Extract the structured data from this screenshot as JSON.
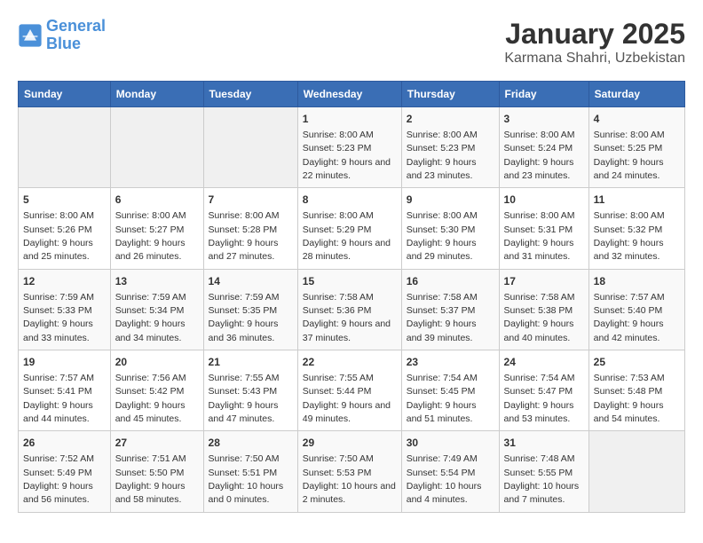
{
  "header": {
    "logo_line1": "General",
    "logo_line2": "Blue",
    "title": "January 2025",
    "subtitle": "Karmana Shahri, Uzbekistan"
  },
  "columns": [
    "Sunday",
    "Monday",
    "Tuesday",
    "Wednesday",
    "Thursday",
    "Friday",
    "Saturday"
  ],
  "weeks": [
    [
      {
        "day": "",
        "sunrise": "",
        "sunset": "",
        "daylight": "",
        "empty": true
      },
      {
        "day": "",
        "sunrise": "",
        "sunset": "",
        "daylight": "",
        "empty": true
      },
      {
        "day": "",
        "sunrise": "",
        "sunset": "",
        "daylight": "",
        "empty": true
      },
      {
        "day": "1",
        "sunrise": "Sunrise: 8:00 AM",
        "sunset": "Sunset: 5:23 PM",
        "daylight": "Daylight: 9 hours and 22 minutes."
      },
      {
        "day": "2",
        "sunrise": "Sunrise: 8:00 AM",
        "sunset": "Sunset: 5:23 PM",
        "daylight": "Daylight: 9 hours and 23 minutes."
      },
      {
        "day": "3",
        "sunrise": "Sunrise: 8:00 AM",
        "sunset": "Sunset: 5:24 PM",
        "daylight": "Daylight: 9 hours and 23 minutes."
      },
      {
        "day": "4",
        "sunrise": "Sunrise: 8:00 AM",
        "sunset": "Sunset: 5:25 PM",
        "daylight": "Daylight: 9 hours and 24 minutes."
      }
    ],
    [
      {
        "day": "5",
        "sunrise": "Sunrise: 8:00 AM",
        "sunset": "Sunset: 5:26 PM",
        "daylight": "Daylight: 9 hours and 25 minutes."
      },
      {
        "day": "6",
        "sunrise": "Sunrise: 8:00 AM",
        "sunset": "Sunset: 5:27 PM",
        "daylight": "Daylight: 9 hours and 26 minutes."
      },
      {
        "day": "7",
        "sunrise": "Sunrise: 8:00 AM",
        "sunset": "Sunset: 5:28 PM",
        "daylight": "Daylight: 9 hours and 27 minutes."
      },
      {
        "day": "8",
        "sunrise": "Sunrise: 8:00 AM",
        "sunset": "Sunset: 5:29 PM",
        "daylight": "Daylight: 9 hours and 28 minutes."
      },
      {
        "day": "9",
        "sunrise": "Sunrise: 8:00 AM",
        "sunset": "Sunset: 5:30 PM",
        "daylight": "Daylight: 9 hours and 29 minutes."
      },
      {
        "day": "10",
        "sunrise": "Sunrise: 8:00 AM",
        "sunset": "Sunset: 5:31 PM",
        "daylight": "Daylight: 9 hours and 31 minutes."
      },
      {
        "day": "11",
        "sunrise": "Sunrise: 8:00 AM",
        "sunset": "Sunset: 5:32 PM",
        "daylight": "Daylight: 9 hours and 32 minutes."
      }
    ],
    [
      {
        "day": "12",
        "sunrise": "Sunrise: 7:59 AM",
        "sunset": "Sunset: 5:33 PM",
        "daylight": "Daylight: 9 hours and 33 minutes."
      },
      {
        "day": "13",
        "sunrise": "Sunrise: 7:59 AM",
        "sunset": "Sunset: 5:34 PM",
        "daylight": "Daylight: 9 hours and 34 minutes."
      },
      {
        "day": "14",
        "sunrise": "Sunrise: 7:59 AM",
        "sunset": "Sunset: 5:35 PM",
        "daylight": "Daylight: 9 hours and 36 minutes."
      },
      {
        "day": "15",
        "sunrise": "Sunrise: 7:58 AM",
        "sunset": "Sunset: 5:36 PM",
        "daylight": "Daylight: 9 hours and 37 minutes."
      },
      {
        "day": "16",
        "sunrise": "Sunrise: 7:58 AM",
        "sunset": "Sunset: 5:37 PM",
        "daylight": "Daylight: 9 hours and 39 minutes."
      },
      {
        "day": "17",
        "sunrise": "Sunrise: 7:58 AM",
        "sunset": "Sunset: 5:38 PM",
        "daylight": "Daylight: 9 hours and 40 minutes."
      },
      {
        "day": "18",
        "sunrise": "Sunrise: 7:57 AM",
        "sunset": "Sunset: 5:40 PM",
        "daylight": "Daylight: 9 hours and 42 minutes."
      }
    ],
    [
      {
        "day": "19",
        "sunrise": "Sunrise: 7:57 AM",
        "sunset": "Sunset: 5:41 PM",
        "daylight": "Daylight: 9 hours and 44 minutes."
      },
      {
        "day": "20",
        "sunrise": "Sunrise: 7:56 AM",
        "sunset": "Sunset: 5:42 PM",
        "daylight": "Daylight: 9 hours and 45 minutes."
      },
      {
        "day": "21",
        "sunrise": "Sunrise: 7:55 AM",
        "sunset": "Sunset: 5:43 PM",
        "daylight": "Daylight: 9 hours and 47 minutes."
      },
      {
        "day": "22",
        "sunrise": "Sunrise: 7:55 AM",
        "sunset": "Sunset: 5:44 PM",
        "daylight": "Daylight: 9 hours and 49 minutes."
      },
      {
        "day": "23",
        "sunrise": "Sunrise: 7:54 AM",
        "sunset": "Sunset: 5:45 PM",
        "daylight": "Daylight: 9 hours and 51 minutes."
      },
      {
        "day": "24",
        "sunrise": "Sunrise: 7:54 AM",
        "sunset": "Sunset: 5:47 PM",
        "daylight": "Daylight: 9 hours and 53 minutes."
      },
      {
        "day": "25",
        "sunrise": "Sunrise: 7:53 AM",
        "sunset": "Sunset: 5:48 PM",
        "daylight": "Daylight: 9 hours and 54 minutes."
      }
    ],
    [
      {
        "day": "26",
        "sunrise": "Sunrise: 7:52 AM",
        "sunset": "Sunset: 5:49 PM",
        "daylight": "Daylight: 9 hours and 56 minutes."
      },
      {
        "day": "27",
        "sunrise": "Sunrise: 7:51 AM",
        "sunset": "Sunset: 5:50 PM",
        "daylight": "Daylight: 9 hours and 58 minutes."
      },
      {
        "day": "28",
        "sunrise": "Sunrise: 7:50 AM",
        "sunset": "Sunset: 5:51 PM",
        "daylight": "Daylight: 10 hours and 0 minutes."
      },
      {
        "day": "29",
        "sunrise": "Sunrise: 7:50 AM",
        "sunset": "Sunset: 5:53 PM",
        "daylight": "Daylight: 10 hours and 2 minutes."
      },
      {
        "day": "30",
        "sunrise": "Sunrise: 7:49 AM",
        "sunset": "Sunset: 5:54 PM",
        "daylight": "Daylight: 10 hours and 4 minutes."
      },
      {
        "day": "31",
        "sunrise": "Sunrise: 7:48 AM",
        "sunset": "Sunset: 5:55 PM",
        "daylight": "Daylight: 10 hours and 7 minutes."
      },
      {
        "day": "",
        "sunrise": "",
        "sunset": "",
        "daylight": "",
        "empty": true
      }
    ]
  ]
}
